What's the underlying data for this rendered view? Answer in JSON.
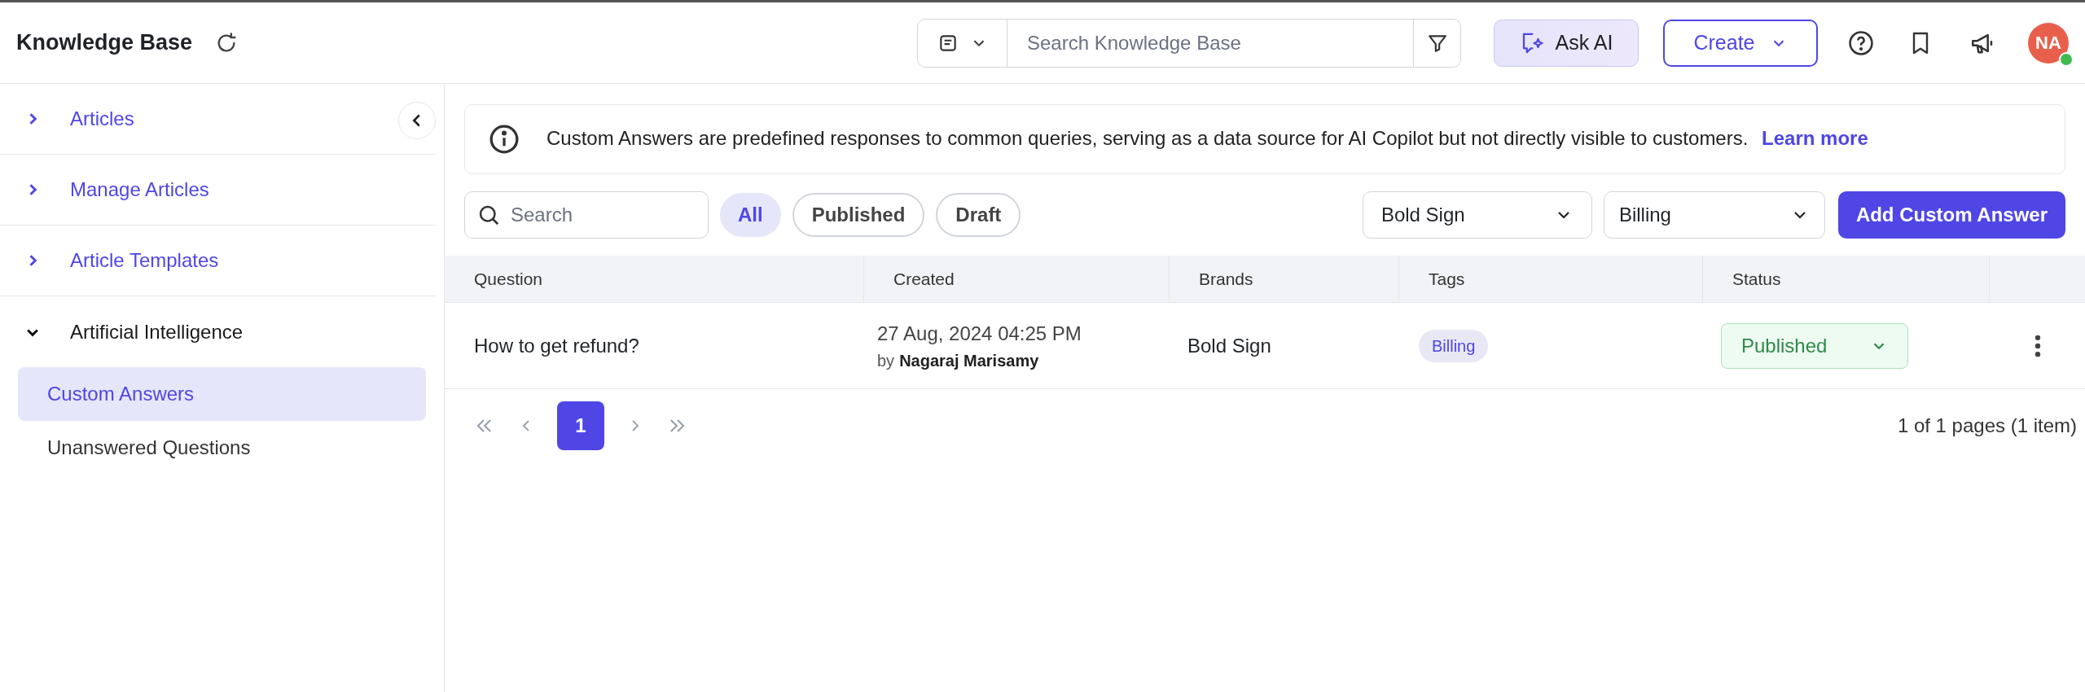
{
  "header": {
    "title": "Knowledge Base",
    "search": {
      "placeholder": "Search Knowledge Base"
    },
    "ask_ai": "Ask AI",
    "create": "Create",
    "avatar": {
      "initials": "NA",
      "online": true
    }
  },
  "sidebar": {
    "items": [
      {
        "label": "Articles",
        "expanded": false
      },
      {
        "label": "Manage Articles",
        "expanded": false
      },
      {
        "label": "Article Templates",
        "expanded": false
      },
      {
        "label": "Artificial Intelligence",
        "expanded": true,
        "children": [
          {
            "label": "Custom Answers",
            "selected": true
          },
          {
            "label": "Unanswered Questions",
            "selected": false
          }
        ]
      }
    ]
  },
  "info": {
    "text": "Custom Answers are predefined responses to common queries, serving as a data source for AI Copilot but not directly visible to customers.",
    "link": "Learn more"
  },
  "filters": {
    "search": {
      "placeholder": "Search"
    },
    "tabs": [
      {
        "label": "All",
        "selected": true
      },
      {
        "label": "Published",
        "selected": false
      },
      {
        "label": "Draft",
        "selected": false
      }
    ],
    "brand": "Bold Sign",
    "tag": "Billing",
    "add_button": "Add Custom Answer"
  },
  "table": {
    "columns": [
      "Question",
      "Created",
      "Brands",
      "Tags",
      "Status"
    ],
    "rows": [
      {
        "question": "How to get refund?",
        "created": "27 Aug, 2024 04:25 PM",
        "by": "by",
        "author": "Nagaraj Marisamy",
        "brand": "Bold Sign",
        "tag": "Billing",
        "status": "Published"
      }
    ]
  },
  "pagination": {
    "pages": [
      {
        "label": "1",
        "selected": true
      }
    ],
    "summary": "1 of 1 pages (1 item)"
  }
}
